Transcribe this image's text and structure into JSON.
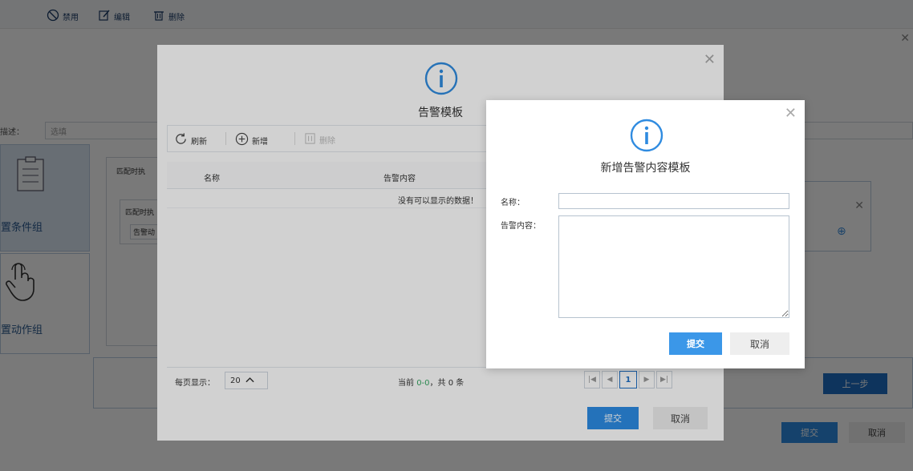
{
  "background": {
    "toolbar": {
      "disable_label": "禁用",
      "edit_label": "编辑",
      "delete_label": "删除"
    },
    "desc_label": "描述：",
    "desc_placeholder": "选填",
    "condition_group_label": "置条件组",
    "action_group_label": "置动作组",
    "inner_title": "匹配时执",
    "inner_box_title": "匹配时执",
    "inner_box_item": "告警动",
    "prev_button": "上一步",
    "submit_button": "提交",
    "cancel_button": "取消"
  },
  "template_modal": {
    "title": "告警模板",
    "toolbar": {
      "refresh_label": "刷新",
      "add_label": "新增",
      "delete_label": "删除"
    },
    "columns": [
      "名称",
      "告警内容"
    ],
    "empty_text": "没有可以显示的数据！",
    "page_size_label": "每页显示：",
    "page_size_value": "20",
    "page_info_prefix": "当前",
    "page_info_range": "0-0",
    "page_info_suffix": "，共 0 条",
    "current_page": "1",
    "pager": {
      "first": "|◀",
      "prev": "◀",
      "next": "▶",
      "last": "▶|"
    },
    "submit_button": "提交",
    "cancel_button": "取消"
  },
  "add_modal": {
    "title": "新增告警内容模板",
    "name_label": "名称：",
    "content_label": "告警内容：",
    "name_value": "",
    "content_value": "",
    "submit_button": "提交",
    "cancel_button": "取消"
  },
  "colors": {
    "primary_blue": "#2d8ce3",
    "dark_blue": "#1f6fc5",
    "icon_blue": "#2f8be0",
    "highlight_green": "#35a862"
  },
  "icons": [
    "disable-icon",
    "edit-icon",
    "trash-icon",
    "close-icon",
    "info-icon",
    "refresh-icon",
    "plus-circle-icon",
    "document-icon",
    "hand-pointer-icon",
    "chevron-up-icon"
  ]
}
